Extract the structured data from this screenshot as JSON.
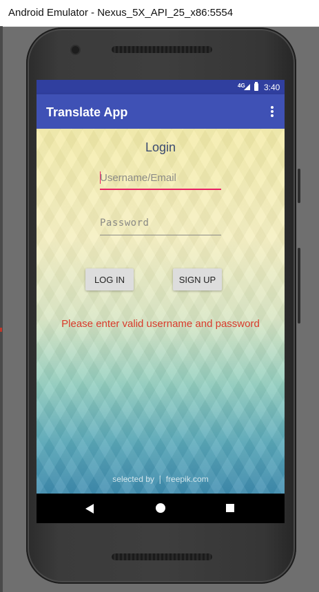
{
  "window": {
    "title": "Android Emulator - Nexus_5X_API_25_x86:5554"
  },
  "status_bar": {
    "network": "4G",
    "time": "3:40",
    "icons": [
      "signal-icon",
      "battery-icon"
    ]
  },
  "app_bar": {
    "title": "Translate App",
    "menu_icon": "overflow-menu-icon"
  },
  "login": {
    "heading": "Login",
    "username_placeholder": "Username/Email",
    "username_value": "",
    "password_placeholder": "Password",
    "password_value": "",
    "login_button": "LOG IN",
    "signup_button": "SIGN UP",
    "error_message": "Please enter valid username and password"
  },
  "background_credit": "selected by ❘ freepik.com",
  "fab": {
    "icon": "mail-icon",
    "color": "#ff4081"
  },
  "nav_bar": {
    "icons": [
      "back-icon",
      "home-icon",
      "recents-icon"
    ]
  },
  "colors": {
    "primary": "#3f51b5",
    "primary_dark": "#303f9f",
    "accent": "#e91e63",
    "error": "#d93a2b"
  }
}
